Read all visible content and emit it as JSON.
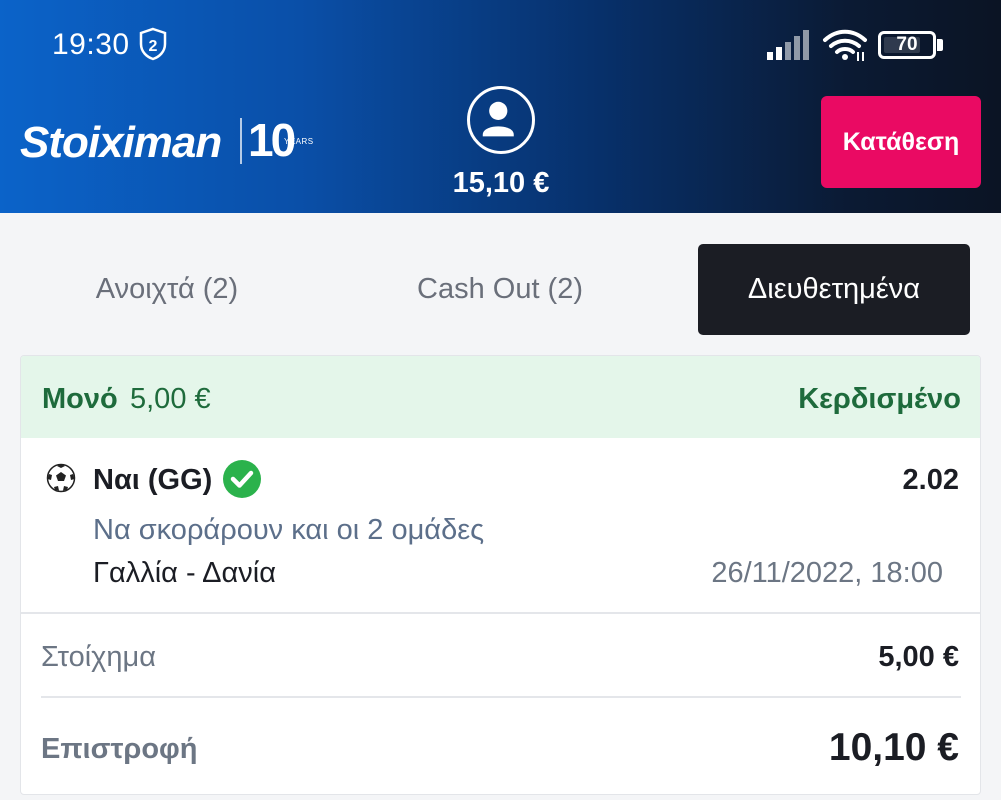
{
  "status_bar": {
    "time": "19:30",
    "shield_badge": "2",
    "battery_level": "70",
    "signal_icon": "signal-icon",
    "wifi_icon": "wifi-icon"
  },
  "header": {
    "brand": "Stoiximan",
    "brand_anniversary": "10",
    "brand_anniversary_sub": "YEARS",
    "balance": "15,10 €",
    "deposit_label": "Κατάθεση"
  },
  "tabs": [
    {
      "label": "Ανοιχτά (2)",
      "active": false
    },
    {
      "label": "Cash Out (2)",
      "active": false
    },
    {
      "label": "Διευθετημένα",
      "active": true
    }
  ],
  "bet": {
    "type": "Μονό",
    "stake_header": "5,00 €",
    "status": "Κερδισμένο",
    "selection": "Ναι (GG)",
    "odds": "2.02",
    "market": "Να σκοράρουν και οι 2 ομάδες",
    "match": "Γαλλία - Δανία",
    "datetime": "26/11/2022, 18:00",
    "stake_label": "Στοίχημα",
    "stake_value": "5,00 €",
    "return_label": "Επιστροφή",
    "return_value": "10,10 €"
  },
  "colors": {
    "deposit": "#ea0a63",
    "won_green": "#1e6b3c",
    "won_bg": "#e4f6ea",
    "check_green": "#2bb24c",
    "active_tab": "#1b1d24"
  }
}
